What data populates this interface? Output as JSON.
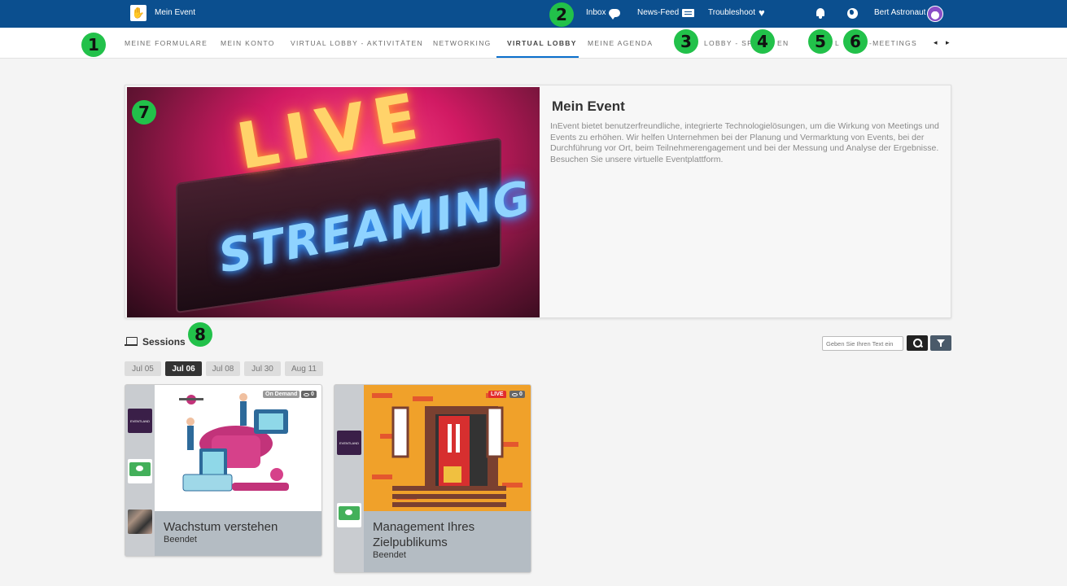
{
  "topbar": {
    "event_name": "Mein Event",
    "inbox_label": "Inbox",
    "newsfeed_label": "News-Feed",
    "troubleshoot_label": "Troubleshoot",
    "user_name": "Bert Astronaut",
    "background_color": "#0b4f8f"
  },
  "nav": {
    "items": [
      {
        "label": "MEINE FORMULARE"
      },
      {
        "label": "MEIN KONTO"
      },
      {
        "label": "VIRTUAL LOBBY - AKTIVITÄTEN"
      },
      {
        "label": "NETWORKING"
      },
      {
        "label": "VIRTUAL LOBBY",
        "active": true
      },
      {
        "label": "MEINE AGENDA"
      },
      {
        "label": "LOBBY - SP"
      },
      {
        "label": "EN"
      },
      {
        "label": "L"
      },
      {
        "label": "-MEETINGS"
      }
    ],
    "arrows": "◂ ▸",
    "accent_color": "#0b6fcc"
  },
  "badges": [
    "1",
    "2",
    "3",
    "4",
    "5",
    "6",
    "7",
    "8"
  ],
  "hero": {
    "image_text_1": "LIVE",
    "image_text_2": "STREAMING",
    "title": "Mein Event",
    "description": "InEvent bietet benutzerfreundliche, integrierte Technologielösungen, um die Wirkung von Meetings und Events zu erhöhen. Wir helfen Unternehmen bei der Planung und Vermarktung von Events, bei der Durchführung vor Ort, beim Teilnehmerengagement und bei der Messung und Analyse der Ergebnisse. Besuchen Sie unsere virtuelle Eventplattform."
  },
  "sessions": {
    "heading": "Sessions",
    "search_placeholder": "Geben Sie Ihren Text ein",
    "dates": [
      {
        "label": "Jul 05"
      },
      {
        "label": "Jul 06",
        "active": true
      },
      {
        "label": "Jul 08"
      },
      {
        "label": "Jul 30"
      },
      {
        "label": "Aug 11"
      }
    ],
    "cards": [
      {
        "title": "Wachstum verstehen",
        "status": "Beendet",
        "tag": "On Demand",
        "views": "0",
        "logo_text": "EVENTLAND"
      },
      {
        "title": "Management Ihres Zielpublikums",
        "status": "Beendet",
        "tag": "LIVE",
        "views": "0",
        "logo_text": "EVENTLAND"
      }
    ]
  },
  "colors": {
    "badge": "#22c14a",
    "live_tag": "#e22c2c"
  }
}
